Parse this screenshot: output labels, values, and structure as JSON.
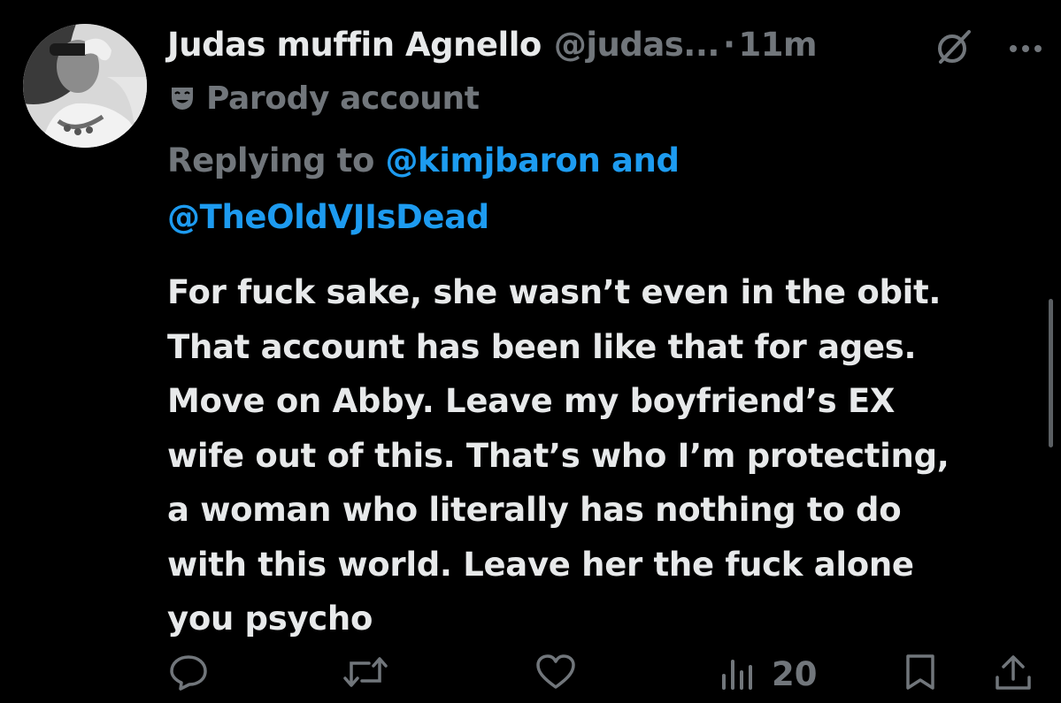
{
  "tweet": {
    "display_name": "Judas muffin Agnello",
    "handle": "@judas...",
    "separator": "·",
    "time": "11m",
    "parody_label": "Parody account",
    "reply_prefix": "Replying to",
    "reply_mentions": [
      "@kimjbaron",
      "@TheOldVJIsDead"
    ],
    "reply_joiner": "and",
    "text": "For fuck sake, she wasn’t even in the obit.\nThat account has been like that for ages.\nMove on Abby. Leave my boyfriend’s EX\nwife out of this. That’s who I’m protecting,\na woman who literally has nothing to do\nwith this world. Leave her the fuck alone\nyou psycho"
  },
  "actions": {
    "views_count": "20",
    "icons": [
      "reply-icon",
      "retweet-icon",
      "like-icon",
      "views-icon",
      "bookmark-icon",
      "share-icon"
    ]
  },
  "colors": {
    "background": "#000000",
    "text_primary": "#e7e9ea",
    "text_secondary": "#71767b",
    "link": "#1d9bf0"
  }
}
